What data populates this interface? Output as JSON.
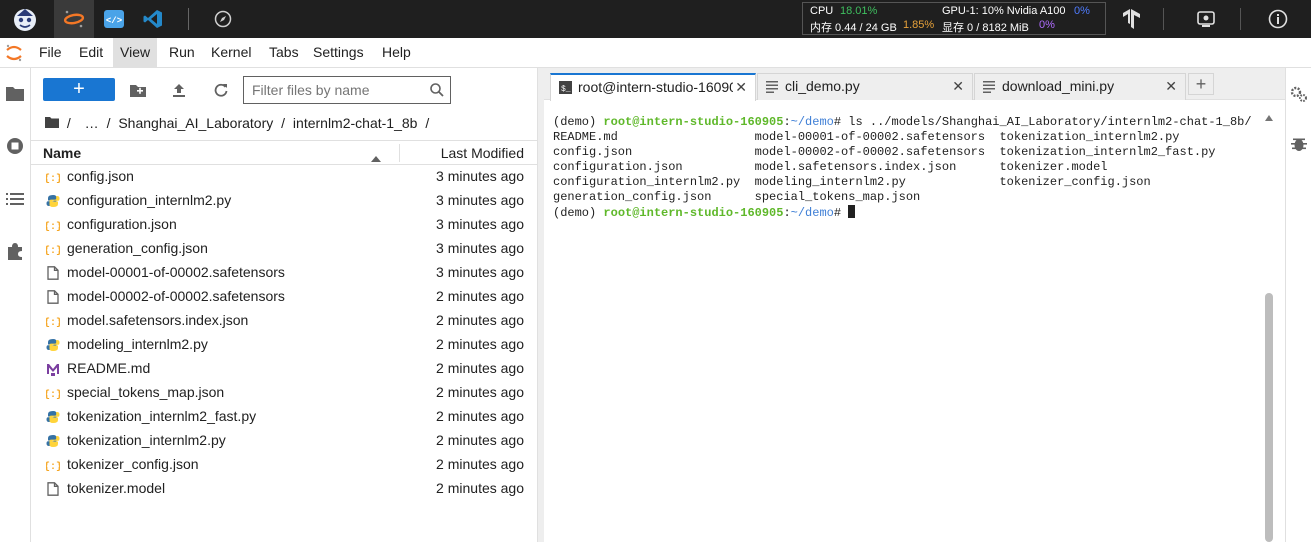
{
  "topbar": {
    "stats": {
      "cpu_label": "CPU",
      "cpu_value": "18.01%",
      "mem_label": "内存 0.44 / 24 GB",
      "mem_value": "1.85%",
      "gpu_label": "GPU-1: 10% Nvidia A100",
      "gpu_value": "0%",
      "vram_label": "显存 0 / 8182 MiB",
      "vram_value": "0%"
    }
  },
  "menu": {
    "items": [
      "File",
      "Edit",
      "View",
      "Run",
      "Kernel",
      "Tabs",
      "Settings",
      "Help"
    ]
  },
  "filebrowser": {
    "new_label": "+",
    "filter_placeholder": "Filter files by name",
    "breadcrumb": [
      "/",
      "…",
      "/",
      "Shanghai_AI_Laboratory",
      "/",
      "internlm2-chat-1_8b",
      "/"
    ],
    "col_name": "Name",
    "col_modified": "Last Modified",
    "files": [
      {
        "name": "config.json",
        "type": "json",
        "modified": "3 minutes ago"
      },
      {
        "name": "configuration_internlm2.py",
        "type": "python",
        "modified": "3 minutes ago"
      },
      {
        "name": "configuration.json",
        "type": "json",
        "modified": "3 minutes ago"
      },
      {
        "name": "generation_config.json",
        "type": "json",
        "modified": "3 minutes ago"
      },
      {
        "name": "model-00001-of-00002.safetensors",
        "type": "file",
        "modified": "3 minutes ago"
      },
      {
        "name": "model-00002-of-00002.safetensors",
        "type": "file",
        "modified": "2 minutes ago"
      },
      {
        "name": "model.safetensors.index.json",
        "type": "json",
        "modified": "2 minutes ago"
      },
      {
        "name": "modeling_internlm2.py",
        "type": "python",
        "modified": "2 minutes ago"
      },
      {
        "name": "README.md",
        "type": "markdown",
        "modified": "2 minutes ago"
      },
      {
        "name": "special_tokens_map.json",
        "type": "json",
        "modified": "2 minutes ago"
      },
      {
        "name": "tokenization_internlm2_fast.py",
        "type": "python",
        "modified": "2 minutes ago"
      },
      {
        "name": "tokenization_internlm2.py",
        "type": "python",
        "modified": "2 minutes ago"
      },
      {
        "name": "tokenizer_config.json",
        "type": "json",
        "modified": "2 minutes ago"
      },
      {
        "name": "tokenizer.model",
        "type": "file",
        "modified": "2 minutes ago"
      }
    ]
  },
  "tabs": [
    {
      "label": "root@intern-studio-16090",
      "icon": "terminal-icon",
      "active": true
    },
    {
      "label": "cli_demo.py",
      "icon": "text-file-icon",
      "active": false
    },
    {
      "label": "download_mini.py",
      "icon": "text-file-icon",
      "active": false
    }
  ],
  "terminal": {
    "prompt_env": "(demo) ",
    "prompt_user": "root@intern-studio-160905",
    "prompt_sep": ":",
    "prompt_path": "~/demo",
    "prompt_end": "# ",
    "command": "ls ../models/Shanghai_AI_Laboratory/internlm2-chat-1_8b/",
    "output": "README.md                   model-00001-of-00002.safetensors  tokenization_internlm2.py\nconfig.json                 model-00002-of-00002.safetensors  tokenization_internlm2_fast.py\nconfiguration.json          model.safetensors.index.json      tokenizer.model\nconfiguration_internlm2.py  modeling_internlm2.py             tokenizer_config.json\ngeneration_config.json      special_tokens_map.json"
  },
  "colors": {
    "accent": "#1976d2",
    "json_icon": "#f5a623",
    "python_blue": "#3572a5",
    "python_yellow": "#ffd43b",
    "markdown_icon": "#7b3fa0",
    "terminal_user": "#5fb82a",
    "terminal_path": "#3f7fd6"
  }
}
